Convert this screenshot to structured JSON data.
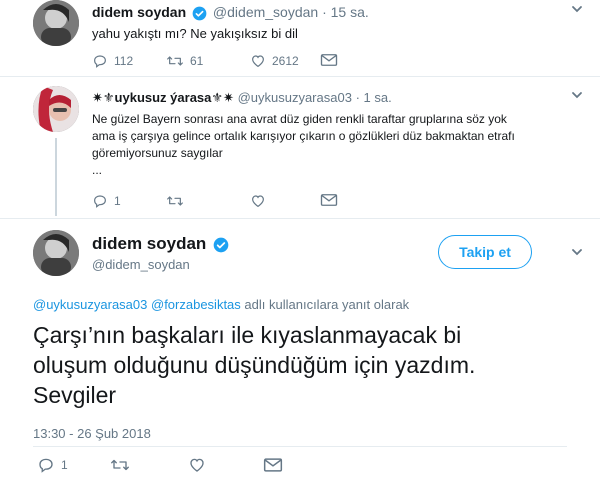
{
  "tweet1": {
    "name": "didem soydan",
    "handle": "@didem_soydan",
    "time": "· 15 sa.",
    "text": "yahu yakıştı mı? Ne yakışıksız bi dil",
    "replies": "112",
    "retweets": "61",
    "likes": "2612"
  },
  "tweet2": {
    "name": "✷⚜uykusuz ýarasa⚜✷",
    "handle": "@uykusuzyarasa03",
    "time": "· 1 sa.",
    "text_lines": [
      "Ne güzel Bayern sonrası ana avrat düz giden renkli taraftar gruplarına söz yok",
      "ama iş çarşıya gelince ortalık karışıyor çıkarın o gözlükleri düz bakmaktan etrafı",
      "göremiyorsunuz saygılar",
      "..."
    ],
    "replies": "1"
  },
  "main": {
    "name": "didem soydan",
    "handle": "@didem_soydan",
    "follow_label": "Takip et",
    "reply_to_handle1": "@uykusuzyarasa03",
    "reply_to_handle2": "@forzabesiktas",
    "reply_to_suffix": "adlı kullanıcılara yanıt olarak",
    "text_lines": [
      "Çarşı’nın başkaları  ile kıyaslanmayacak bi",
      "oluşum olduğunu düşündüğüm için yazdım.",
      "Sevgiler"
    ],
    "timestamp": "13:30 - 26 Şub 2018",
    "replies": "1"
  },
  "colors": {
    "accent": "#1da1f2",
    "link": "#1b95e0",
    "muted": "#657786",
    "divider": "#e6ecf0"
  }
}
